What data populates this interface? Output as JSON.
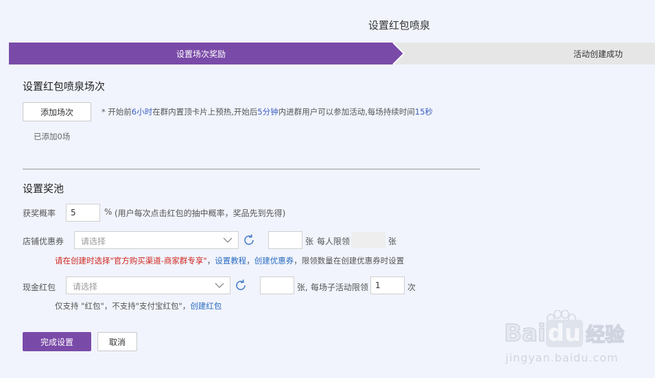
{
  "page": {
    "title": "设置红包喷泉"
  },
  "steps": [
    {
      "label": "设置场次奖励",
      "active": true
    },
    {
      "label": "活动创建成功",
      "active": false
    }
  ],
  "colors": {
    "primary": "#7a4aa8",
    "background": "#f1f4fc",
    "step_inactive": "#e6e6e6",
    "warning": "#d0261f",
    "link": "#2a6cc2",
    "highlight": "#3b5dbf"
  },
  "session": {
    "title": "设置红包喷泉场次",
    "add_button": "添加场次",
    "note": {
      "part1": "* 开始前",
      "hl1": "6小时",
      "part2": "在群内置顶卡片上预热,开始后",
      "hl2": "5分钟",
      "part3": "内进群用户可以参加活动,每场持续时间",
      "hl3": "15秒"
    },
    "added_text": "已添加0场"
  },
  "pool": {
    "title": "设置奖池",
    "probability": {
      "label": "获奖概率",
      "value": "5",
      "unit": "%",
      "hint": "(用户每次点击红包的抽中概率，奖品先到先得)"
    },
    "coupon": {
      "label": "店铺优惠券",
      "select_placeholder": "请选择",
      "refresh_icon": "refresh-icon",
      "count_value": "",
      "count_unit": "张",
      "per_user_label": "每人限领",
      "per_user_value": "",
      "per_user_unit": "张",
      "warning": "请在创建时选择\"官方购买渠道-商家群专享\"",
      "comma1": "，",
      "link1": "设置教程",
      "comma2": "，",
      "link2": "创建优惠券",
      "comma3": "，",
      "tail": "限领数量在创建优惠券时设置"
    },
    "cash": {
      "label": "现金红包",
      "select_placeholder": "请选择",
      "refresh_icon": "refresh-icon",
      "count_value": "",
      "count_unit": "张,",
      "per_label": "每场子活动限领",
      "per_value": "1",
      "per_unit": "次",
      "note": "仅支持 \"红包\"，不支持\"支付宝红包\"，",
      "link": "创建红包"
    }
  },
  "actions": {
    "submit": "完成设置",
    "cancel": "取消"
  },
  "watermark": {
    "brand_a": "Bai",
    "brand_b": "du",
    "brand_cn": "经验",
    "url": "jingyan.baidu.com"
  }
}
